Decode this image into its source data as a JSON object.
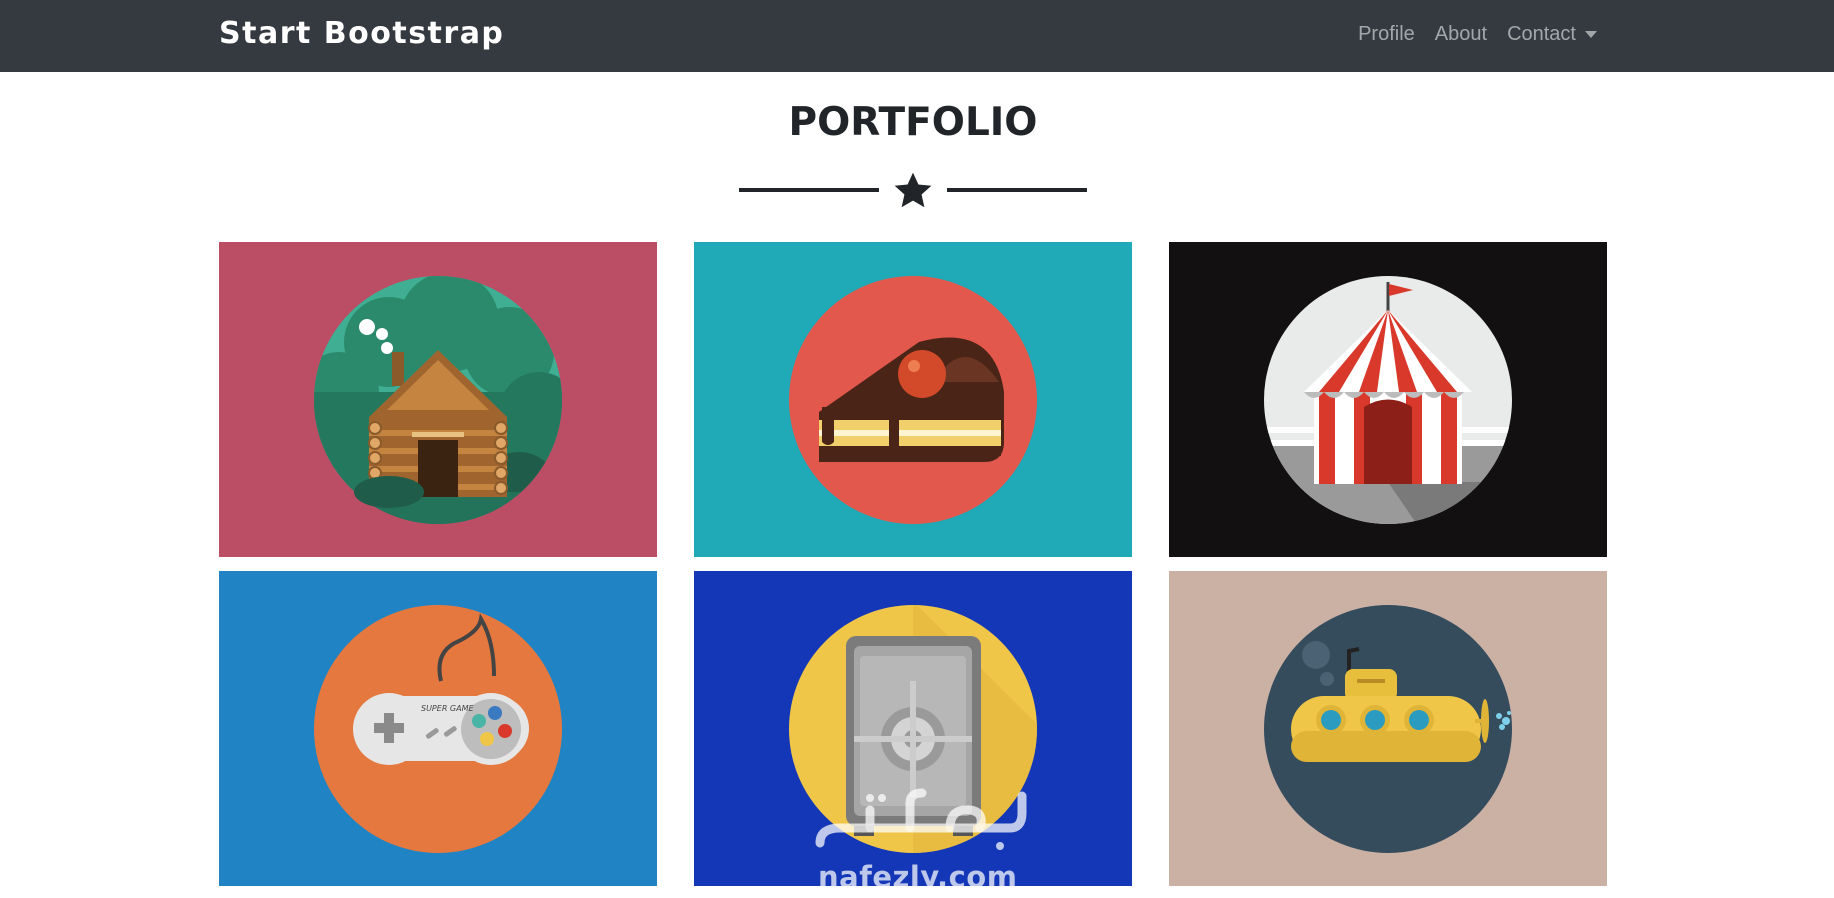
{
  "navbar": {
    "brand": "Start Bootstrap",
    "links": [
      {
        "label": "Profile"
      },
      {
        "label": "About"
      },
      {
        "label": "Contact"
      }
    ]
  },
  "portfolio": {
    "title": "PORTFOLIO",
    "divider_icon": "star-icon",
    "items": [
      {
        "subject": "cabin-icon",
        "bg": "#bb4d65",
        "circle": "#3fae92"
      },
      {
        "subject": "cake-icon",
        "bg": "#20a9b7",
        "circle": "#e2584c"
      },
      {
        "subject": "circus-tent-icon",
        "bg": "#131012",
        "circle": "#e9ebea"
      },
      {
        "subject": "game-controller-icon",
        "bg": "#2083c3",
        "circle": "#e5783f",
        "label": "SUPER GAME"
      },
      {
        "subject": "safe-icon",
        "bg": "#1337b6",
        "circle": "#f0c648"
      },
      {
        "subject": "submarine-icon",
        "bg": "#cbb1a4",
        "circle": "#354c5d"
      }
    ]
  },
  "watermark": {
    "site": "nafezly.com"
  }
}
